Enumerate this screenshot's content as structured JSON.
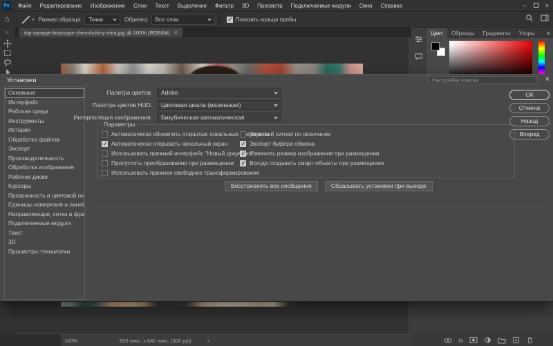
{
  "menubar": {
    "logo": "Ps",
    "items": [
      "Файл",
      "Редактирование",
      "Изображение",
      "Слои",
      "Текст",
      "Выделение",
      "Фильтр",
      "3D",
      "Просмотр",
      "Подключаемые модули",
      "Окно",
      "Справка"
    ],
    "minimize": "–",
    "close": "×"
  },
  "options_bar": {
    "home": "⌂",
    "sample_size_label": "Размер образца:",
    "sample_size_value": "Точка",
    "sample_label": "Образец:",
    "sample_value": "Все слои",
    "show_ring": {
      "label": "Показать кольцо пробы",
      "checked": true
    }
  },
  "document_tab": {
    "title": "top-samyye-krasivyye-zhenshchiny-mira.jpg @ 100% (RGB/8#)",
    "close": "×"
  },
  "toolbar": {
    "more": "»"
  },
  "dock": {
    "collapse_left": "«",
    "collapse_right": "»",
    "panel_menu": "≡",
    "tabs": [
      {
        "label": "Цвет",
        "active": true
      },
      {
        "label": "Образцы"
      },
      {
        "label": "Градиенты"
      },
      {
        "label": "Узоры"
      }
    ],
    "color_panel": {
      "foreground": "#000000",
      "background": "#ffffff",
      "hue_field": "red"
    }
  },
  "dialog": {
    "title": "Установки",
    "search_placeholder": "Настройки поиска",
    "close": "×",
    "sidebar": [
      {
        "label": "Основные",
        "selected": true
      },
      {
        "label": "Интерфейс"
      },
      {
        "label": "Рабочая среда"
      },
      {
        "label": "Инструменты"
      },
      {
        "label": "История"
      },
      {
        "label": "Обработка файлов"
      },
      {
        "label": "Экспорт"
      },
      {
        "label": "Производительность"
      },
      {
        "label": "Обработка изображения"
      },
      {
        "label": "Рабочие диски"
      },
      {
        "label": "Курсоры"
      },
      {
        "label": "Прозрачность и цветовой охват"
      },
      {
        "label": "Единицы измерения и линейки"
      },
      {
        "label": "Направляющие, сетка и фрагменты"
      },
      {
        "label": "Подключаемые модули"
      },
      {
        "label": "Текст"
      },
      {
        "label": "3D"
      },
      {
        "label": "Просмотры технологии"
      }
    ],
    "fields": [
      {
        "label": "Палитра цветов:",
        "value": "Adobe"
      },
      {
        "label": "Палитра цветов HUD:",
        "value": "Цветовая шкала (маленькая)"
      },
      {
        "label": "Интерполяция изображения:",
        "value": "Бикубическая автоматическая"
      }
    ],
    "options_group": {
      "title": "Параметры",
      "left": [
        {
          "label": "Автоматически обновлять открытые локальные документы",
          "checked": false
        },
        {
          "label": "Автоматически открывать начальный экран",
          "checked": true
        },
        {
          "label": "Использовать прежний интерфейс \"Новый документ\"",
          "checked": false
        },
        {
          "label": "Пропустить преобразование при размещении",
          "checked": false
        },
        {
          "label": "Использовать прежнее свободное трансформирование",
          "checked": false
        }
      ],
      "right": [
        {
          "label": "Звуковой сигнал по окончании",
          "checked": false
        },
        {
          "label": "Экспорт буфера обмена",
          "checked": true
        },
        {
          "label": "Изменить размер изображения при размещении",
          "checked": true
        },
        {
          "label": "Всегда создавать смарт-объекты при размещении",
          "checked": true
        }
      ]
    },
    "action_buttons": [
      "Восстановить все сообщения",
      "Сбрасывать установки при выходе"
    ],
    "nav_buttons": [
      {
        "label": "ОК",
        "primary": true
      },
      {
        "label": "Отмена"
      },
      {
        "label": "Назад"
      },
      {
        "label": "Вперед"
      }
    ]
  },
  "status_bar": {
    "zoom": "100%",
    "doc_info": "800 пикс. x 640 пикс. (300 ppi)",
    "arrow": "›"
  },
  "layers_bar": {
    "fx": "fx"
  },
  "colors": {
    "dialog_bg": "#484848",
    "ui_bg": "#323232",
    "canvas_bg": "#333333",
    "accent_logo": "#3caeff"
  }
}
